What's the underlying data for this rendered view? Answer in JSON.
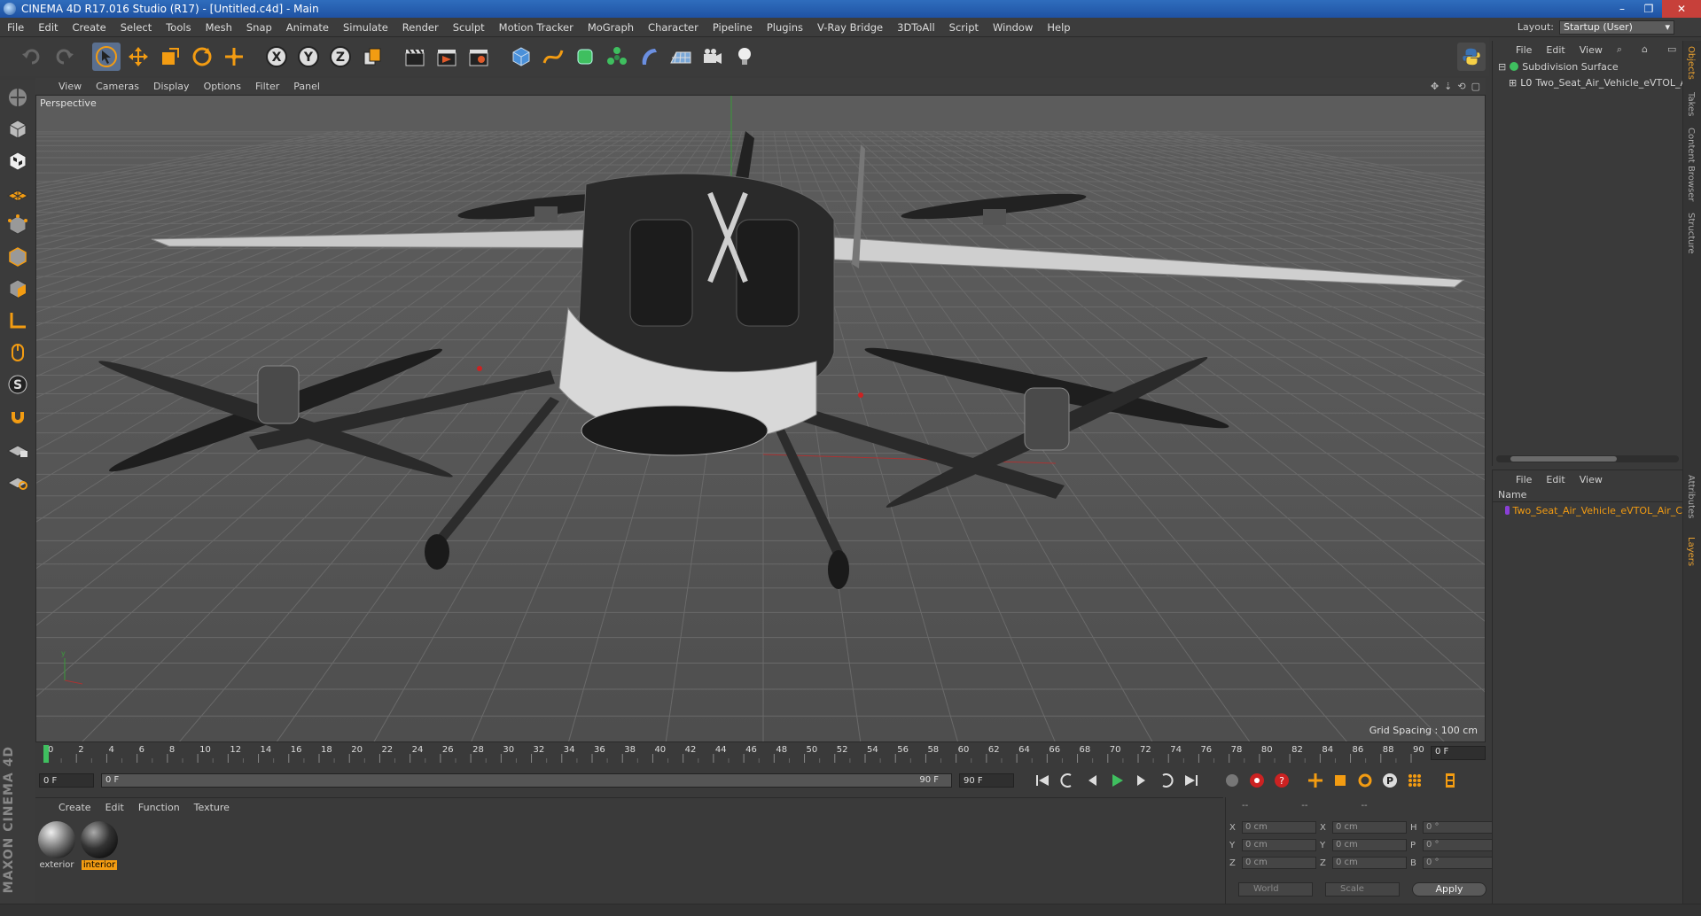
{
  "window": {
    "title": "CINEMA 4D R17.016 Studio (R17) - [Untitled.c4d] - Main",
    "controls": [
      "–",
      "❐",
      "✕"
    ]
  },
  "menubar": {
    "items": [
      "File",
      "Edit",
      "Create",
      "Select",
      "Tools",
      "Mesh",
      "Snap",
      "Animate",
      "Simulate",
      "Render",
      "Sculpt",
      "Motion Tracker",
      "MoGraph",
      "Character",
      "Pipeline",
      "Plugins",
      "V-Ray Bridge",
      "3DToAll",
      "Script",
      "Window",
      "Help"
    ],
    "layout_label": "Layout:",
    "layout_value": "Startup (User)"
  },
  "viewport": {
    "menu": [
      "View",
      "Cameras",
      "Display",
      "Options",
      "Filter",
      "Panel"
    ],
    "camera_label": "Perspective",
    "grid_spacing": "Grid Spacing : 100 cm"
  },
  "timeline": {
    "ticks": [
      "0",
      "2",
      "4",
      "6",
      "8",
      "10",
      "12",
      "14",
      "16",
      "18",
      "20",
      "22",
      "24",
      "26",
      "28",
      "30",
      "32",
      "34",
      "36",
      "38",
      "40",
      "42",
      "44",
      "46",
      "48",
      "50",
      "52",
      "54",
      "56",
      "58",
      "60",
      "62",
      "64",
      "66",
      "68",
      "70",
      "72",
      "74",
      "76",
      "78",
      "80",
      "82",
      "84",
      "86",
      "88",
      "90"
    ],
    "current_frame_display": "0 F"
  },
  "transport": {
    "start_field": "0 F",
    "range_start": "0 F",
    "range_end": "90 F",
    "end_field": "90 F"
  },
  "material_manager": {
    "menu": [
      "Create",
      "Edit",
      "Function",
      "Texture"
    ],
    "materials": [
      {
        "name": "exterior",
        "selected": false
      },
      {
        "name": "interior",
        "selected": true
      }
    ]
  },
  "coordinates": {
    "headers": [
      "--",
      "--",
      "--"
    ],
    "rows": [
      {
        "pos_label": "X",
        "pos_value": "0 cm",
        "size_label": "X",
        "size_value": "0 cm",
        "rot_label": "H",
        "rot_value": "0 °"
      },
      {
        "pos_label": "Y",
        "pos_value": "0 cm",
        "size_label": "Y",
        "size_value": "0 cm",
        "rot_label": "P",
        "rot_value": "0 °"
      },
      {
        "pos_label": "Z",
        "pos_value": "0 cm",
        "size_label": "Z",
        "size_value": "0 cm",
        "rot_label": "B",
        "rot_value": "0 °"
      }
    ],
    "space_dropdown": "World",
    "mode_dropdown": "Scale",
    "apply_label": "Apply"
  },
  "object_manager": {
    "menu": [
      "File",
      "Edit",
      "View"
    ],
    "objects": [
      {
        "name": "Subdivision Surface",
        "color": "#3fbf5f",
        "indent": 0
      },
      {
        "name": "Two_Seat_Air_Vehicle_eVTOL_Air_",
        "color": "#9a9a9a",
        "indent": 1
      }
    ]
  },
  "layer_manager": {
    "menu": [
      "File",
      "Edit",
      "View"
    ],
    "column_name": "Name",
    "layers": [
      {
        "name": "Two_Seat_Air_Vehicle_eVTOL_Air_C",
        "color": "#8a3fd6"
      }
    ]
  },
  "side_tabs": [
    {
      "label": "Objects",
      "active": true
    },
    {
      "label": "Takes",
      "active": false
    },
    {
      "label": "Content Browser",
      "active": false
    },
    {
      "label": "Structure",
      "active": false
    },
    {
      "label": "Attributes",
      "active": false
    },
    {
      "label": "Layers",
      "active": true
    }
  ],
  "brand": "MAXON CINEMA 4D",
  "colors": {
    "accent_orange": "#f39c12",
    "titlebar_blue": "#2f6dbd",
    "active_tool": "#5a6f8f"
  }
}
